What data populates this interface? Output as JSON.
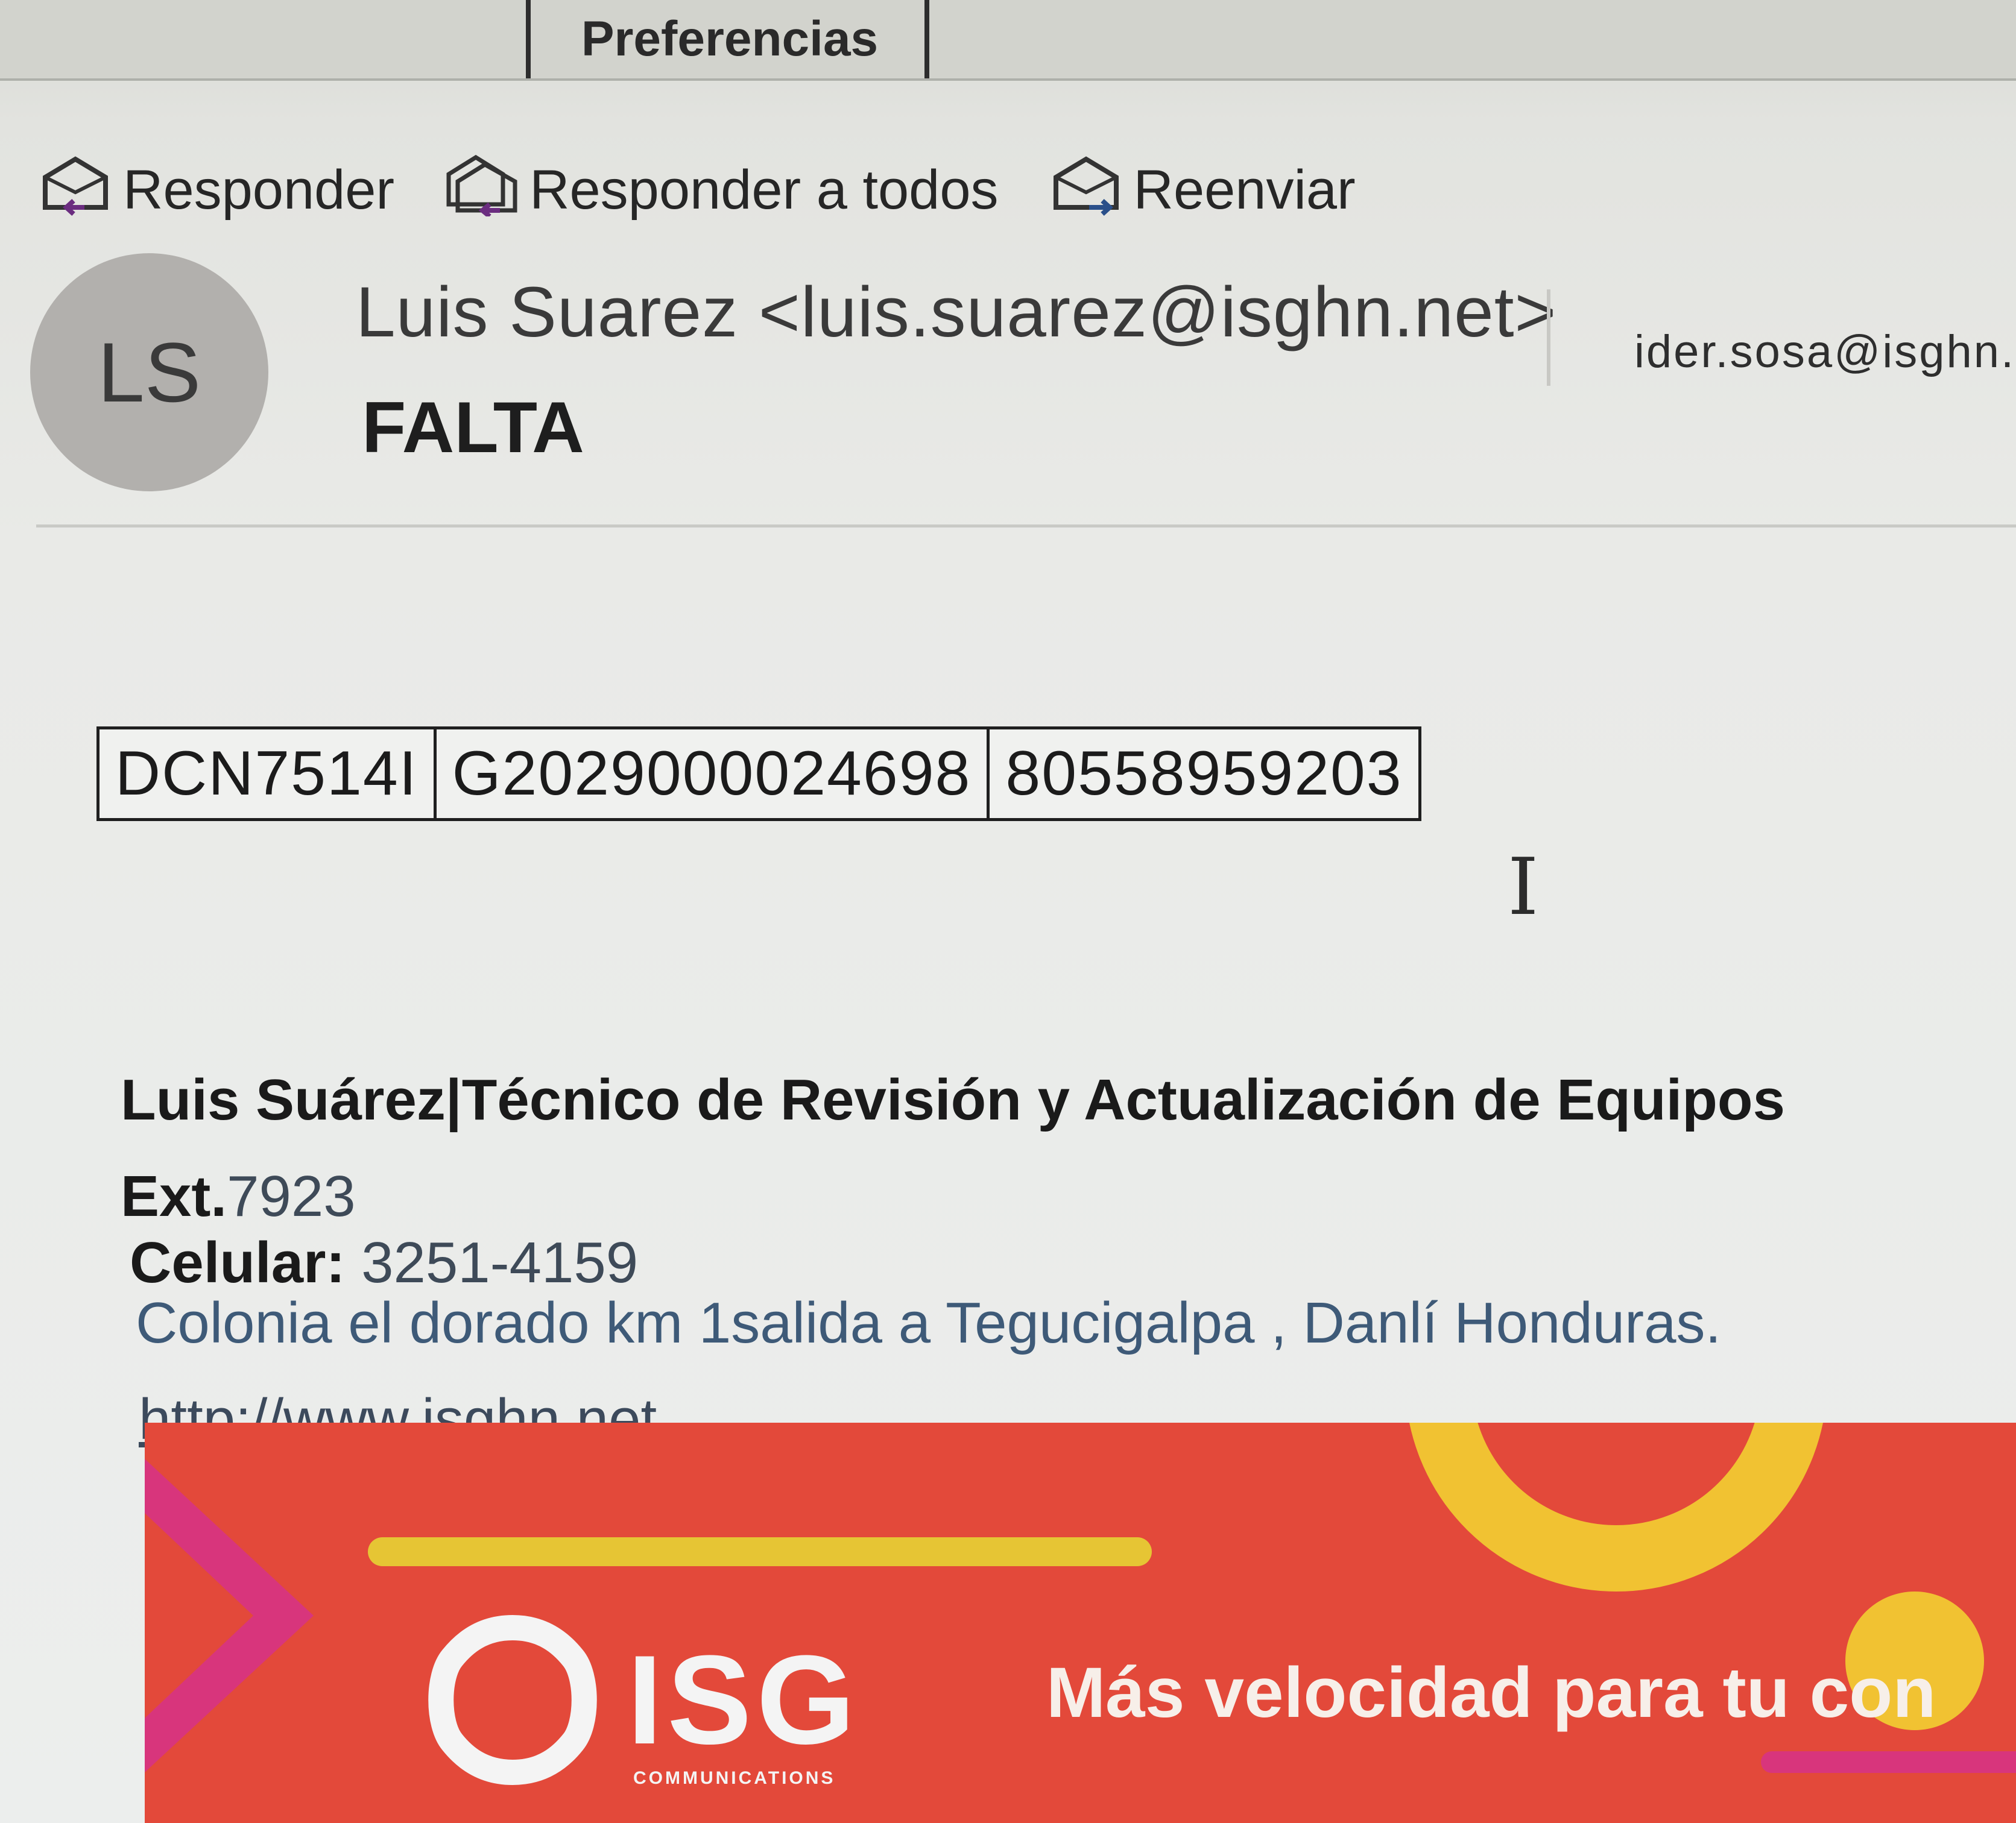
{
  "tabs": {
    "preferences_label": "Preferencias"
  },
  "actions": {
    "reply_label": "Responder",
    "reply_all_label": "Responder a todos",
    "forward_label": "Reenviar"
  },
  "message": {
    "avatar_initials": "LS",
    "from": "Luis Suarez <luis.suarez@isghn.net>",
    "subject": "FALTA",
    "to": "ider.sosa@isghn.n"
  },
  "code_table": {
    "cells": [
      "DCN7514I",
      "G2029000024698",
      "80558959203"
    ]
  },
  "signature": {
    "name_title": "Luis Suárez|Técnico de Revisión y Actualización de Equipos",
    "ext_label": "Ext.",
    "ext_value": "7923",
    "cell_label": "Celular:",
    "cell_value": "3251-4159",
    "address": "Colonia el dorado km 1salida a Tegucigalpa , Danlí Honduras.",
    "website": "http://www.isghn.net"
  },
  "banner": {
    "brand": "ISG",
    "brand_sub": "COMMUNICATIONS",
    "tagline": "Más velocidad para tu con",
    "colors": {
      "background": "#e3493a",
      "yellow": "#f1c232",
      "magenta": "#d8357c"
    }
  },
  "icons": [
    "reply-icon",
    "reply-all-icon",
    "forward-icon",
    "text-cursor-icon"
  ]
}
